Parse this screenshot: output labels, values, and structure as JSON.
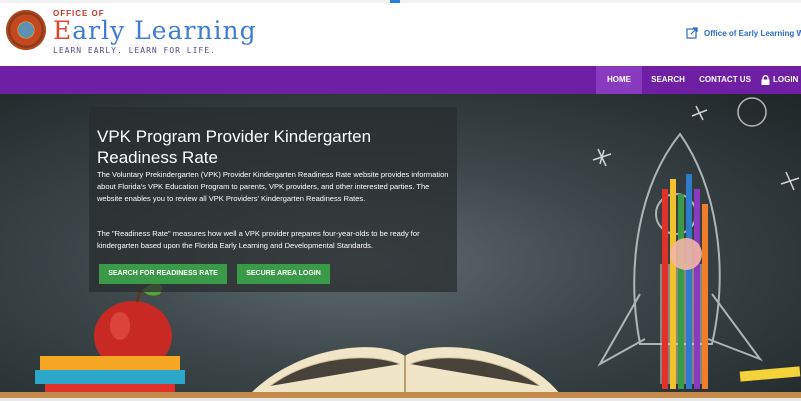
{
  "header": {
    "logo_office": "OFFICE OF",
    "logo_title_first_letter": "E",
    "logo_title_rest": "arly Learning",
    "logo_tagline": "LEARN EARLY. LEARN FOR LIFE.",
    "external_link_label": "Office of Early Learning Websi"
  },
  "nav": {
    "items": [
      {
        "label": "HOME",
        "active": true
      },
      {
        "label": "SEARCH"
      },
      {
        "label": "CONTACT US"
      },
      {
        "label": "LOGIN"
      }
    ]
  },
  "hero": {
    "title": "VPK Program Provider Kindergarten Readiness Rate",
    "paragraph1": "The Voluntary Prekindergarten (VPK) Provider Kindergarten Readiness Rate website provides information about Florida's VPK Education Program to parents, VPK providers, and other interested parties. The website enables you to review all VPK Providers' Kindergarten Readiness Rates.",
    "paragraph2": "The \"Readiness Rate\" measures how well a VPK provider prepares four-year-olds to be ready for kindergarten based upon the Florida Early Learning and Developmental Standards.",
    "button_search": "SEARCH FOR READINESS RATE",
    "button_login": "SECURE AREA LOGIN"
  },
  "colors": {
    "nav_bg": "#6f1fa3",
    "nav_active_bg": "#8a3abf",
    "button_green": "#3b9a48",
    "link_blue": "#2b6cc4"
  },
  "icons": [
    "florida-seal-icon",
    "external-link-icon",
    "lock-icon"
  ]
}
